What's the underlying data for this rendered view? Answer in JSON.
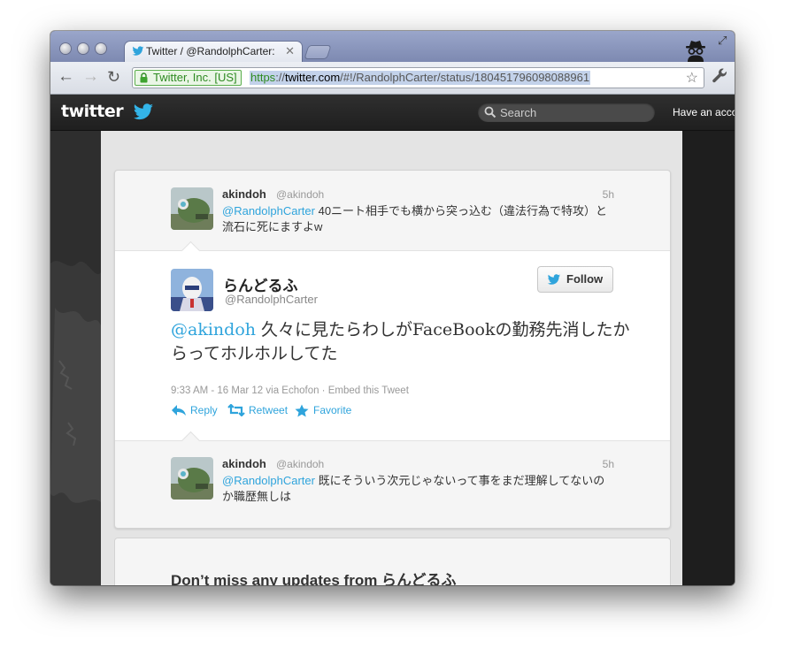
{
  "browser": {
    "tab_title": "Twitter / @RandolphCarter:  ",
    "ev_label": "Twitter, Inc. [US]",
    "url_scheme": "https",
    "url_sep": "://",
    "url_host": "twitter.com",
    "url_path": "/#!/RandolphCarter/status/180451796098088961",
    "back_icon": "arrow-left",
    "forward_icon": "arrow-right",
    "reload_icon": "reload",
    "star_icon": "star-outline",
    "menu_icon": "wrench"
  },
  "twitter_bar": {
    "logo_text": "twitter",
    "search_placeholder": "Search",
    "account_prompt": "Have an acco"
  },
  "reply_above": {
    "name": "akindoh",
    "handle": "@akindoh",
    "time": "5h",
    "mention": "@RandolphCarter",
    "text": " 40ニート相手でも横から突っ込む（違法行為で特攻）と流石に死にますよw"
  },
  "main_tweet": {
    "name": "らんどるふ",
    "handle": "@RandolphCarter",
    "follow_label": "Follow",
    "mention": "@akindoh",
    "text": " 久々に見たらわしがFaceBookの勤務先消したからってホルホルしてた",
    "meta": "9:33 AM - 16 Mar 12 via Echofon · Embed this Tweet",
    "actions": {
      "reply": "Reply",
      "retweet": "Retweet",
      "favorite": "Favorite"
    }
  },
  "reply_below": {
    "name": "akindoh",
    "handle": "@akindoh",
    "time": "5h",
    "mention": "@RandolphCarter",
    "text": " 既にそういう次元じゃないって事をまだ理解してないのか職歴無しは"
  },
  "updates_card": {
    "heading": "Don’t miss any updates from らんどるふ"
  },
  "colors": {
    "link": "#2fa4dc",
    "ev_green": "#2e8a22",
    "twitter_bar": "#262626"
  }
}
